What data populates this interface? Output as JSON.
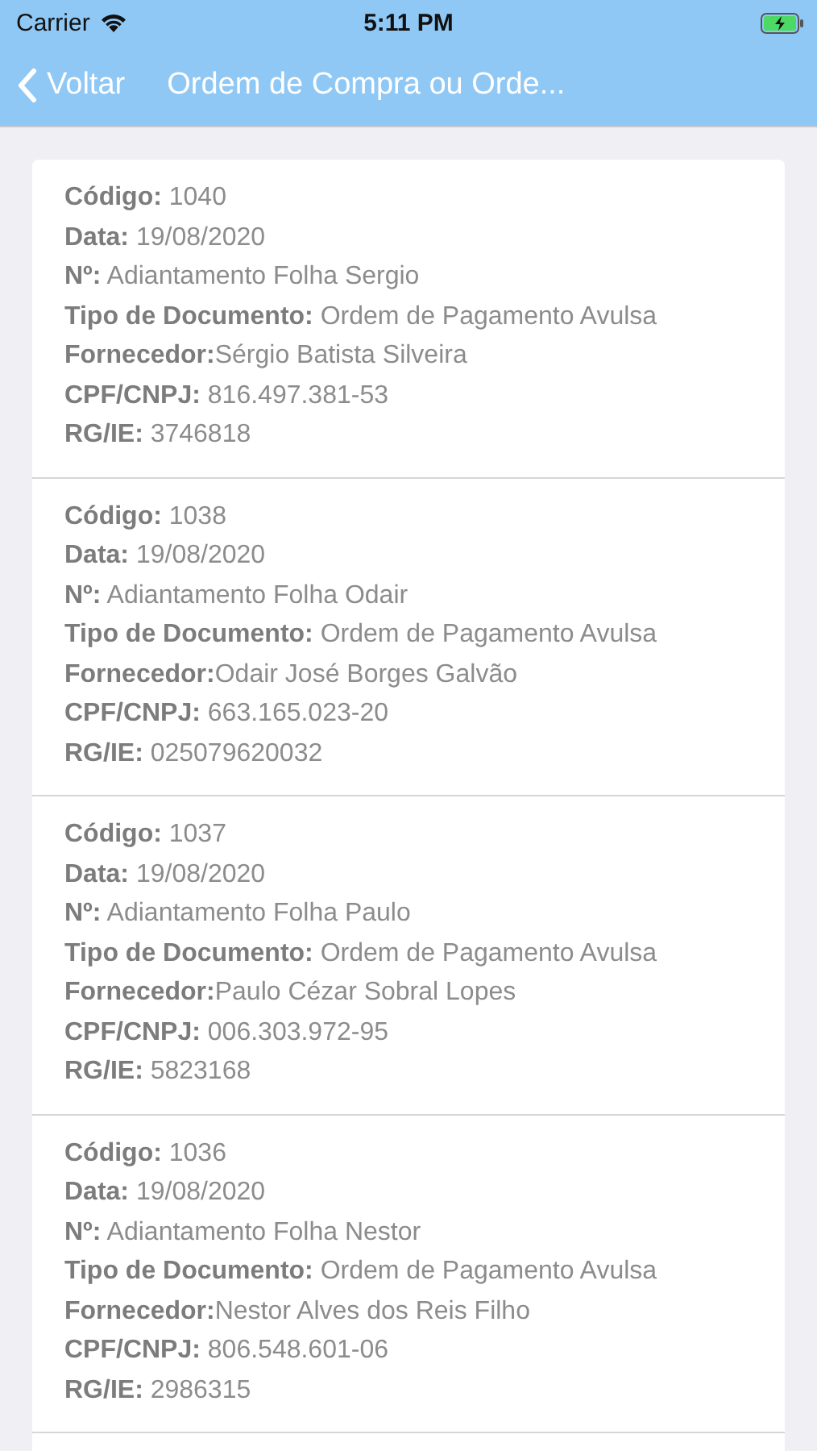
{
  "status_bar": {
    "carrier": "Carrier",
    "time": "5:11 PM"
  },
  "nav": {
    "back": "Voltar",
    "title": "Ordem de Compra ou Orde..."
  },
  "records": [
    {
      "fields": [
        {
          "label": "Código:",
          "value": " 1040"
        },
        {
          "label": "Data:",
          "value": " 19/08/2020"
        },
        {
          "label": "Nº:",
          "value": " Adiantamento Folha Sergio"
        },
        {
          "label": "Tipo de Documento:",
          "value": " Ordem de Pagamento Avulsa"
        },
        {
          "label": "Fornecedor:",
          "value": "Sérgio Batista Silveira"
        },
        {
          "label": "CPF/CNPJ:",
          "value": " 816.497.381-53"
        },
        {
          "label": "RG/IE:",
          "value": " 3746818"
        }
      ]
    },
    {
      "fields": [
        {
          "label": "Código:",
          "value": " 1038"
        },
        {
          "label": "Data:",
          "value": " 19/08/2020"
        },
        {
          "label": "Nº:",
          "value": " Adiantamento Folha Odair"
        },
        {
          "label": "Tipo de Documento:",
          "value": " Ordem de Pagamento Avulsa"
        },
        {
          "label": "Fornecedor:",
          "value": "Odair José Borges Galvão"
        },
        {
          "label": "CPF/CNPJ:",
          "value": " 663.165.023-20"
        },
        {
          "label": "RG/IE:",
          "value": " 025079620032"
        }
      ]
    },
    {
      "fields": [
        {
          "label": "Código:",
          "value": " 1037"
        },
        {
          "label": "Data:",
          "value": " 19/08/2020"
        },
        {
          "label": "Nº:",
          "value": " Adiantamento Folha Paulo"
        },
        {
          "label": "Tipo de Documento:",
          "value": " Ordem de Pagamento Avulsa"
        },
        {
          "label": "Fornecedor:",
          "value": "Paulo Cézar Sobral Lopes"
        },
        {
          "label": "CPF/CNPJ:",
          "value": " 006.303.972-95"
        },
        {
          "label": "RG/IE:",
          "value": " 5823168"
        }
      ]
    },
    {
      "fields": [
        {
          "label": "Código:",
          "value": " 1036"
        },
        {
          "label": "Data:",
          "value": " 19/08/2020"
        },
        {
          "label": "Nº:",
          "value": " Adiantamento Folha Nestor"
        },
        {
          "label": "Tipo de Documento:",
          "value": " Ordem de Pagamento Avulsa"
        },
        {
          "label": "Fornecedor:",
          "value": "Nestor Alves dos Reis Filho"
        },
        {
          "label": "CPF/CNPJ:",
          "value": " 806.548.601-06"
        },
        {
          "label": "RG/IE:",
          "value": " 2986315"
        }
      ]
    }
  ]
}
